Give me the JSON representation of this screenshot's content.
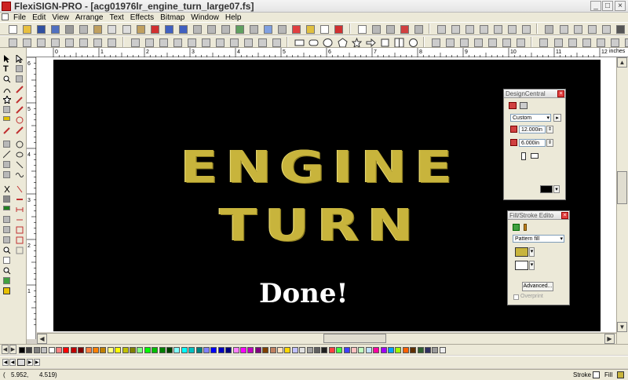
{
  "window": {
    "title": "FlexiSIGN-PRO - [acg01976lr_engine_turn_large07.fs]",
    "controls": [
      "_",
      "□",
      "×"
    ]
  },
  "menu": [
    "File",
    "Edit",
    "View",
    "Arrange",
    "Text",
    "Effects",
    "Bitmap",
    "Window",
    "Help"
  ],
  "ruler": {
    "units": "inches",
    "h_labels": [
      "0",
      "1",
      "2",
      "3",
      "4",
      "5",
      "6",
      "7",
      "8",
      "9",
      "10",
      "11",
      "12"
    ],
    "v_labels": [
      "6",
      "5",
      "4",
      "3",
      "2",
      "1"
    ]
  },
  "artwork": {
    "line1": "ENGINE",
    "line2": "TURN",
    "caption": "Done!",
    "text_color": "#c8b43c",
    "background": "#000000"
  },
  "design_central": {
    "title": "DesignCentral",
    "mode": "Custom",
    "width": "12.000in",
    "height": "6.000in"
  },
  "fill_stroke": {
    "title": "Fill/Stroke Edito",
    "fill_type": "Pattern fill",
    "advanced_label": "Advanced...",
    "overprint_label": "Overprint"
  },
  "status": {
    "x": "5.952,",
    "y": "4.519)",
    "open": "(",
    "stroke_label": "Stroke",
    "fill_label": "Fill"
  },
  "palette": [
    "#000000",
    "#404040",
    "#808080",
    "#c0c0c0",
    "#ffffff",
    "#ff8080",
    "#ff0000",
    "#c00000",
    "#800000",
    "#ff8040",
    "#ff8000",
    "#c08000",
    "#ffff80",
    "#ffff00",
    "#c0c000",
    "#808000",
    "#80ff80",
    "#00ff00",
    "#00c000",
    "#008000",
    "#004000",
    "#80ffff",
    "#00ffff",
    "#00c0c0",
    "#008080",
    "#8080ff",
    "#0000ff",
    "#0000c0",
    "#000080",
    "#ff80ff",
    "#ff00ff",
    "#c000c0",
    "#800080",
    "#804000",
    "#c08060",
    "#ffe0c0",
    "#ffd700",
    "#c0c0ff",
    "#e0e0e0",
    "#a0a0a0",
    "#606060",
    "#202020",
    "#ff4040",
    "#40ff40",
    "#4040ff",
    "#ffc0c0",
    "#c0ffc0",
    "#c0e0ff",
    "#ff00a0",
    "#a000ff",
    "#00a0ff",
    "#a0ff00",
    "#ff6000",
    "#603000",
    "#306030",
    "#303060",
    "#999999",
    "#eeeeee"
  ]
}
